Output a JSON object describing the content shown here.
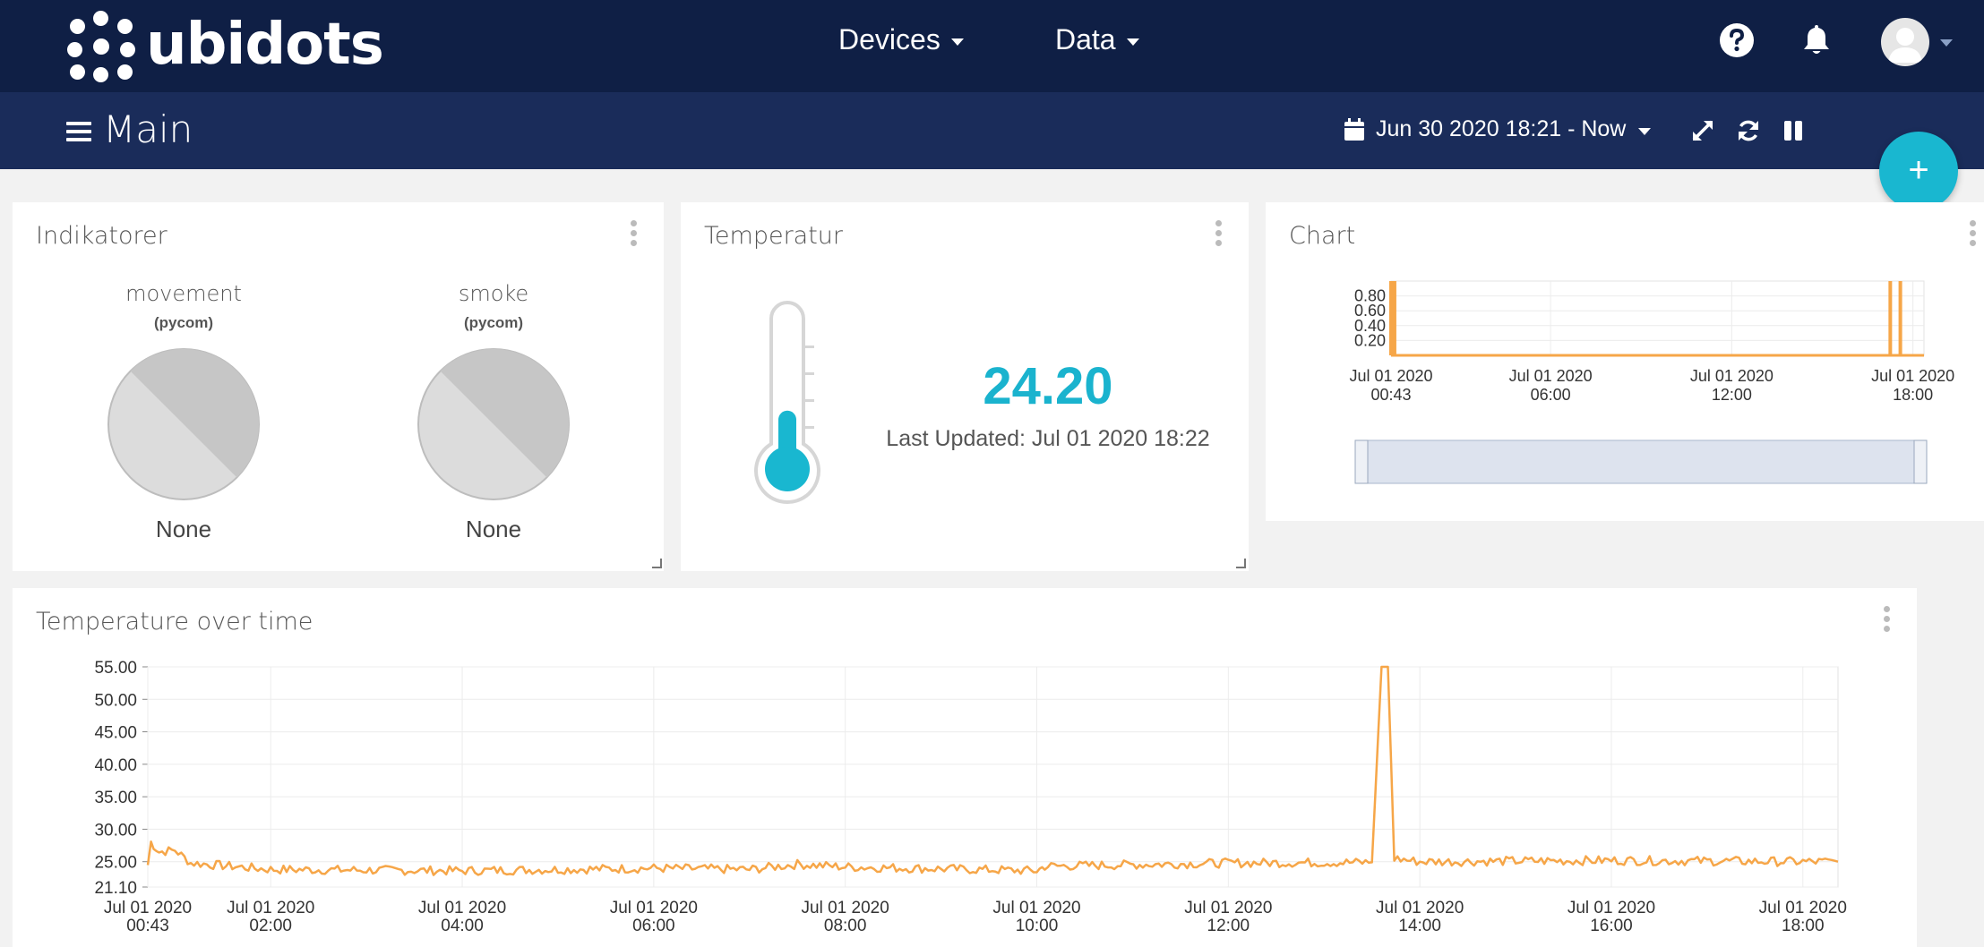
{
  "app": {
    "logo_text": "ubidots"
  },
  "nav": {
    "devices": "Devices",
    "data": "Data"
  },
  "dashboard": {
    "title": "Main",
    "date_range": "Jun 30 2020 18:21 - Now"
  },
  "widgets": {
    "indikatorer": {
      "title": "Indikatorer",
      "items": [
        {
          "label": "movement",
          "device": "(pycom)",
          "value": "None"
        },
        {
          "label": "smoke",
          "device": "(pycom)",
          "value": "None"
        }
      ]
    },
    "temperatur": {
      "title": "Temperatur",
      "value": "24.20",
      "last_updated": "Last Updated: Jul 01 2020 18:22",
      "fill_level": 0.42
    },
    "chart": {
      "title": "Chart"
    },
    "temp_over_time": {
      "title": "Temperature over time"
    }
  },
  "colors": {
    "navy": "#0f1f45",
    "subnav": "#1a2c5a",
    "accent": "#19b7d0",
    "series": "#f6a648"
  },
  "icons": {
    "help": "help-icon",
    "bell": "bell-icon",
    "avatar": "user-avatar",
    "calendar": "calendar-icon",
    "expand": "expand-icon",
    "refresh": "refresh-icon",
    "pause": "pause-icon",
    "add": "plus-icon"
  },
  "chart_data": [
    {
      "type": "line",
      "title": "Chart",
      "ylim": [
        0,
        1
      ],
      "y_ticks": [
        "0.80",
        "0.60",
        "0.40",
        "0.20"
      ],
      "x_ticks": [
        {
          "line1": "Jul 01 2020",
          "line2": "00:43"
        },
        {
          "line1": "Jul 01 2020",
          "line2": "06:00"
        },
        {
          "line1": "Jul 01 2020",
          "line2": "12:00"
        },
        {
          "line1": "Jul 01 2020",
          "line2": "18:00"
        }
      ],
      "series": [
        {
          "values_desc": "mostly 0 with spikes to 1",
          "spike_times": [
            "00:43",
            "00:45",
            "00:50",
            "17:15",
            "17:35"
          ]
        }
      ]
    },
    {
      "type": "line",
      "title": "Temperature over time",
      "ylim": [
        21.1,
        55.0
      ],
      "y_ticks": [
        "55.00",
        "50.00",
        "45.00",
        "40.00",
        "35.00",
        "30.00",
        "25.00",
        "21.10"
      ],
      "x_ticks": [
        {
          "line1": "Jul 01 2020",
          "line2": "00:43"
        },
        {
          "line1": "Jul 01 2020",
          "line2": "02:00"
        },
        {
          "line1": "Jul 01 2020",
          "line2": "04:00"
        },
        {
          "line1": "Jul 01 2020",
          "line2": "06:00"
        },
        {
          "line1": "Jul 01 2020",
          "line2": "08:00"
        },
        {
          "line1": "Jul 01 2020",
          "line2": "10:00"
        },
        {
          "line1": "Jul 01 2020",
          "line2": "12:00"
        },
        {
          "line1": "Jul 01 2020",
          "line2": "14:00"
        },
        {
          "line1": "Jul 01 2020",
          "line2": "16:00"
        },
        {
          "line1": "Jul 01 2020",
          "line2": "18:00"
        }
      ],
      "series": [
        {
          "points": [
            [
              "00:43",
              24.5
            ],
            [
              "00:45",
              28.0
            ],
            [
              "00:50",
              26.5
            ],
            [
              "01:00",
              26.8
            ],
            [
              "01:10",
              24.8
            ],
            [
              "02:00",
              23.8
            ],
            [
              "04:00",
              23.6
            ],
            [
              "06:00",
              24.0
            ],
            [
              "07:00",
              23.8
            ],
            [
              "07:30",
              24.6
            ],
            [
              "08:00",
              24.2
            ],
            [
              "10:00",
              23.6
            ],
            [
              "10:05",
              24.3
            ],
            [
              "12:00",
              24.8
            ],
            [
              "13:30",
              24.9
            ],
            [
              "13:36",
              55.0
            ],
            [
              "13:40",
              55.0
            ],
            [
              "13:44",
              25.5
            ],
            [
              "14:00",
              25.0
            ],
            [
              "16:00",
              25.2
            ],
            [
              "18:00",
              25.0
            ],
            [
              "18:22",
              25.0
            ]
          ]
        }
      ]
    }
  ]
}
